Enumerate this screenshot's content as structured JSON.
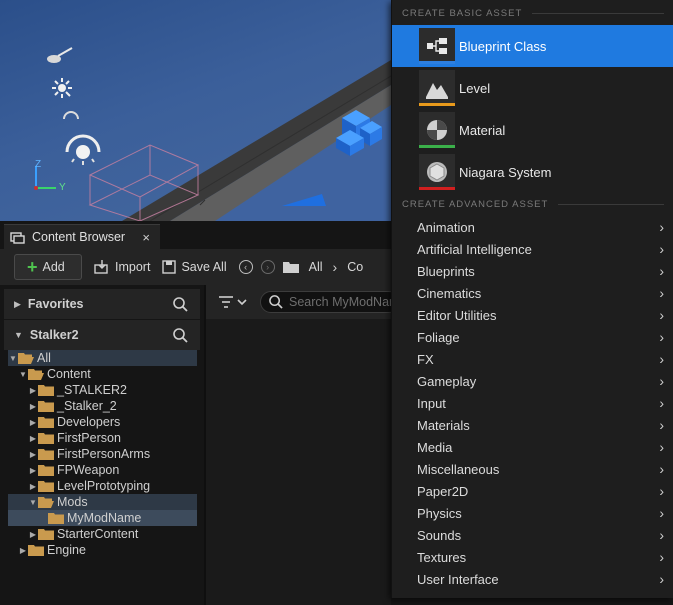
{
  "content_browser": {
    "tab_title": "Content Browser",
    "tab_close": "×",
    "toolbar": {
      "add_label": "Add",
      "import_label": "Import",
      "save_all_label": "Save All",
      "path_all": "All",
      "path_next": "Co"
    },
    "favorites_label": "Favorites",
    "project_label": "Stalker2",
    "search_placeholder": "Search MyModName",
    "tree": [
      {
        "label": "All",
        "depth": 0,
        "expanded": true
      },
      {
        "label": "Content",
        "depth": 1,
        "expanded": true
      },
      {
        "label": "_STALKER2",
        "depth": 2,
        "expanded": false
      },
      {
        "label": "_Stalker_2",
        "depth": 2,
        "expanded": false
      },
      {
        "label": "Developers",
        "depth": 2,
        "expanded": false
      },
      {
        "label": "FirstPerson",
        "depth": 2,
        "expanded": false
      },
      {
        "label": "FirstPersonArms",
        "depth": 2,
        "expanded": false
      },
      {
        "label": "FPWeapon",
        "depth": 2,
        "expanded": false
      },
      {
        "label": "LevelPrototyping",
        "depth": 2,
        "expanded": false
      },
      {
        "label": "Mods",
        "depth": 2,
        "expanded": true
      },
      {
        "label": "MyModName",
        "depth": 3,
        "expanded": null
      },
      {
        "label": "StarterContent",
        "depth": 2,
        "expanded": false
      },
      {
        "label": "Engine",
        "depth": 1,
        "expanded": false
      }
    ]
  },
  "viewport": {
    "axis_z": "Z",
    "axis_y": "Y"
  },
  "menu": {
    "basic_header": "CREATE BASIC ASSET",
    "advanced_header": "CREATE ADVANCED ASSET",
    "basic_items": [
      {
        "label": "Blueprint Class",
        "icon": "blueprint-class-icon",
        "stripe": "#2d7fe0",
        "selected": true
      },
      {
        "label": "Level",
        "icon": "level-icon",
        "stripe": "#e89a1c",
        "selected": false
      },
      {
        "label": "Material",
        "icon": "material-icon",
        "stripe": "#3bb04a",
        "selected": false
      },
      {
        "label": "Niagara System",
        "icon": "niagara-system-icon",
        "stripe": "#d11f1f",
        "selected": false
      }
    ],
    "advanced_items": [
      "Animation",
      "Artificial Intelligence",
      "Blueprints",
      "Cinematics",
      "Editor Utilities",
      "Foliage",
      "FX",
      "Gameplay",
      "Input",
      "Materials",
      "Media",
      "Miscellaneous",
      "Paper2D",
      "Physics",
      "Sounds",
      "Textures",
      "User Interface"
    ],
    "chevron": "›"
  },
  "colors": {
    "accent": "#1f7ae0",
    "folder": "#c99a4e",
    "add_green": "#4fc34f"
  }
}
